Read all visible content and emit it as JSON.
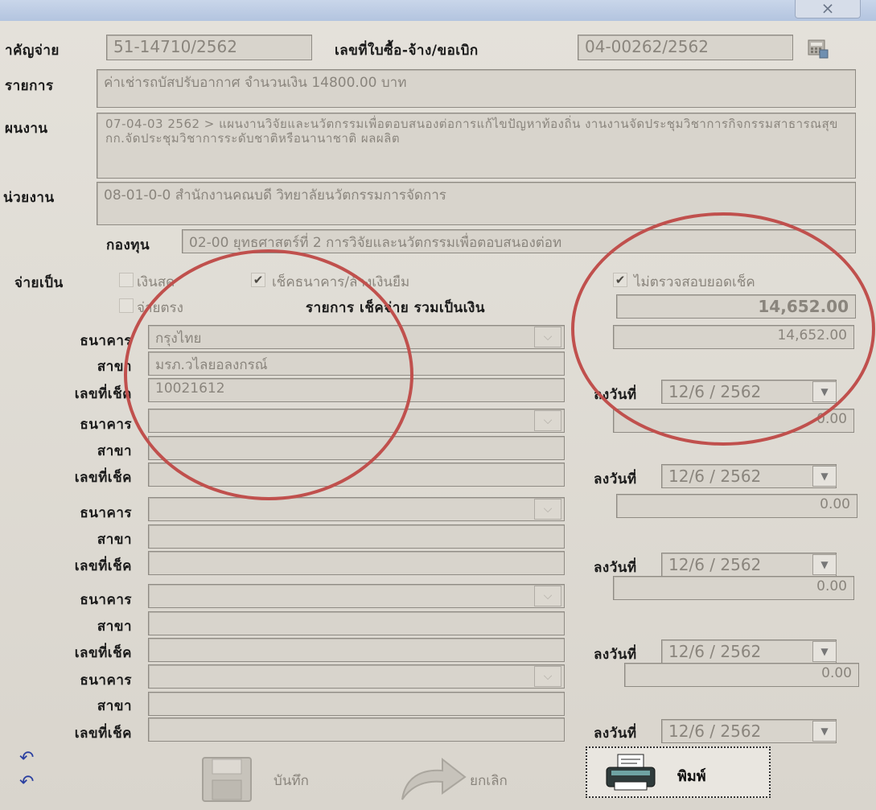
{
  "window": {
    "close_glyph": "⨯"
  },
  "header": {
    "contract_label": "าคัญจ่าย",
    "contract_value": "51-14710/2562",
    "po_label": "เลขที่ใบซื้อ-จ้าง/ขอเบิก",
    "po_value": "04-00262/2562"
  },
  "item": {
    "label": "รายการ",
    "value": "ค่าเช่ารถบัสปรับอากาศ จำนวนเงิน 14800.00 บาท"
  },
  "plan": {
    "label": "ผนงาน",
    "value": "07-04-03 2562 > แผนงานวิจัยและนวัตกรรมเพื่อตอบสนองต่อการแก้ไขปัญหาท้องถิ่น งานงานจัดประชุมวิชาการกิจกรรมสาธารณสุข กก.จัดประชุมวิชาการระดับชาติหรือนานาชาติ ผลผลิต"
  },
  "unit": {
    "label": "น่วยงาน",
    "value": "08-01-0-0 สำนักงานคณบดี วิทยาลัยนวัตกรรมการจัดการ"
  },
  "fund": {
    "label": "กองทุน",
    "value": "02-00 ยุทธศาสตร์ที่ 2 การวิจัยและนวัตกรรมเพื่อตอบสนองต่อท"
  },
  "payment": {
    "label": "จ่ายเป็น",
    "cash_label": "เงินสด",
    "cheque_label": "เช็คธนาคาร/ล้างเงินยืม",
    "cheque_checked": true,
    "no_verify_label": "ไม่ตรวจสอบยอดเช็ค",
    "no_verify_checked": true,
    "direct_label": "จ่ายตรง",
    "total_label": "รายการ เช็คจ่าย รวมเป็นเงิน",
    "total_value": "14,652.00"
  },
  "cheques": [
    {
      "bank_label": "ธนาคาร",
      "bank": "กรุงไทย",
      "branch_label": "สาขา",
      "branch": "มรภ.วไลยอลงกรณ์",
      "no_label": "เลขที่เช็ค",
      "number": "10021612",
      "date_label": "ลงวันที่",
      "date": "12/6 / 2562",
      "amount": "14,652.00"
    },
    {
      "bank_label": "ธนาคาร",
      "bank": "",
      "branch_label": "สาขา",
      "branch": "",
      "no_label": "เลขที่เช็ค",
      "number": "",
      "date_label": "ลงวันที่",
      "date": "12/6 / 2562",
      "amount": "0.00"
    },
    {
      "bank_label": "ธนาคาร",
      "bank": "",
      "branch_label": "สาขา",
      "branch": "",
      "no_label": "เลขที่เช็ค",
      "number": "",
      "date_label": "ลงวันที่",
      "date": "12/6 / 2562",
      "amount": "0.00"
    },
    {
      "bank_label": "ธนาคาร",
      "bank": "",
      "branch_label": "สาขา",
      "branch": "",
      "no_label": "เลขที่เช็ค",
      "number": "",
      "date_label": "ลงวันที่",
      "date": "12/6 / 2562",
      "amount": "0.00"
    },
    {
      "bank_label": "ธนาคาร",
      "bank": "",
      "branch_label": "สาขา",
      "branch": "",
      "no_label": "เลขที่เช็ค",
      "number": "",
      "date_label": "ลงวันที่",
      "date": "12/6 / 2562",
      "amount": "0.00"
    }
  ],
  "footer": {
    "undo_glyph": "↶",
    "save_label": "บันทึก",
    "cancel_label": "ยกเลิก",
    "print_label": "พิมพ์"
  },
  "colors": {
    "annotation_circle": "#c0504d"
  }
}
